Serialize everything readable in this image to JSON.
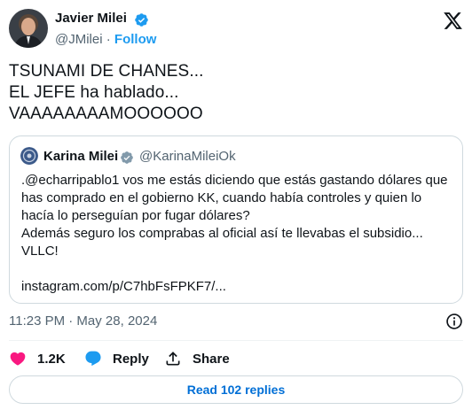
{
  "tweet": {
    "author": {
      "name": "Javier Milei",
      "handle": "@JMilei",
      "separator": "·",
      "follow_label": "Follow"
    },
    "text": "TSUNAMI DE CHANES...\nEL JEFE ha hablado...\nVAAAAAAAAMOOOOOO",
    "timestamp": "11:23 PM · May 28, 2024",
    "actions": {
      "like_count": "1.2K",
      "reply_label": "Reply",
      "share_label": "Share"
    },
    "read_replies_label": "Read 102 replies"
  },
  "quote": {
    "name": "Karina Milei",
    "handle": "@KarinaMileiOk",
    "text": ".@echarripablo1 vos me estás diciendo que estás gastando dólares que has comprado en el gobierno KK, cuando había controles y quien lo hacía lo perseguían por fugar dólares?\nAdemás seguro los comprabas al oficial así te llevabas el subsidio...\nVLLC!",
    "link": "instagram.com/p/C7hbFsFPKF7/..."
  },
  "colors": {
    "verified": "#1d9bf0",
    "verified_gray": "#829aab",
    "like": "#f91880",
    "reply": "#1d9bf0",
    "link_blue": "#006fd6"
  },
  "icons": [
    "verified-badge-icon",
    "x-logo-icon",
    "gray-badge-icon",
    "info-icon",
    "heart-icon",
    "reply-bubble-icon",
    "share-icon"
  ]
}
